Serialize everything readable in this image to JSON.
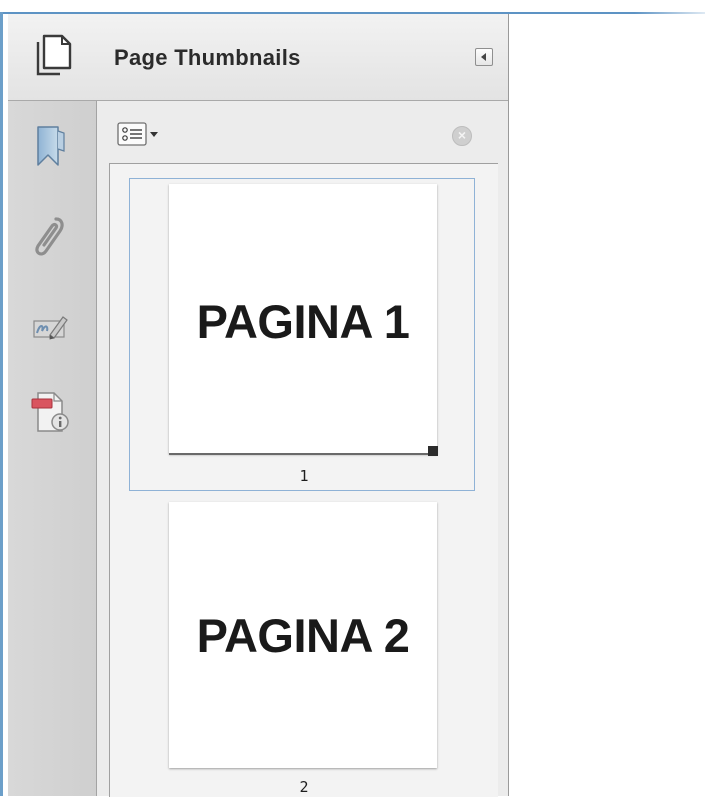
{
  "panel": {
    "title": "Page Thumbnails",
    "header_icon": "page-thumbnails-icon",
    "collapse_icon": "collapse-panel-icon"
  },
  "side_rail": {
    "items": [
      {
        "name": "bookmark-icon"
      },
      {
        "name": "attachment-paperclip-icon"
      },
      {
        "name": "signatures-icon"
      },
      {
        "name": "document-info-icon"
      }
    ]
  },
  "toolbar": {
    "options_icon": "thumbnail-options-icon",
    "close_icon": "close-panel-icon",
    "close_glyph": "×"
  },
  "thumbnails": [
    {
      "content": "PAGINA 1",
      "label": "1",
      "selected": true
    },
    {
      "content": "PAGINA 2",
      "label": "2",
      "selected": false
    }
  ],
  "colors": {
    "selection_border": "#8fb2d6",
    "window_border": "#6c9fc9"
  }
}
